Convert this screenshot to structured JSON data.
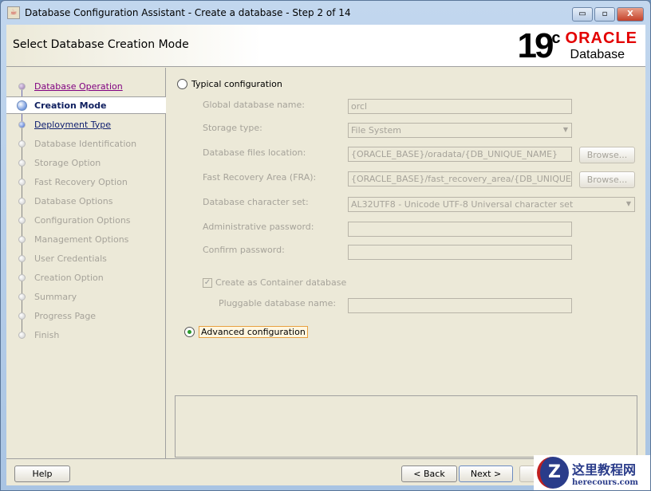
{
  "window": {
    "title": "Database Configuration Assistant - Create a database - Step 2 of 14",
    "minimize": "▭",
    "maximize": "▫",
    "close": "X"
  },
  "header": {
    "title": "Select Database Creation Mode",
    "logo": {
      "version": "19",
      "sup": "c",
      "brand": "ORACLE",
      "product": "Database"
    }
  },
  "steps": [
    {
      "label": "Database Operation",
      "state": "visited"
    },
    {
      "label": "Creation Mode",
      "state": "cur"
    },
    {
      "label": "Deployment Type",
      "state": "next"
    },
    {
      "label": "Database Identification",
      "state": "disabled"
    },
    {
      "label": "Storage Option",
      "state": "disabled"
    },
    {
      "label": "Fast Recovery Option",
      "state": "disabled"
    },
    {
      "label": "Database Options",
      "state": "disabled"
    },
    {
      "label": "Configuration Options",
      "state": "disabled"
    },
    {
      "label": "Management Options",
      "state": "disabled"
    },
    {
      "label": "User Credentials",
      "state": "disabled"
    },
    {
      "label": "Creation Option",
      "state": "disabled"
    },
    {
      "label": "Summary",
      "state": "disabled"
    },
    {
      "label": "Progress Page",
      "state": "disabled"
    },
    {
      "label": "Finish",
      "state": "disabled"
    }
  ],
  "form": {
    "typical_label": "Typical configuration",
    "global_db_name_label": "Global database name:",
    "global_db_name": "orcl",
    "storage_type_label": "Storage type:",
    "storage_type": "File System",
    "db_files_location_label": "Database files location:",
    "db_files_location": "{ORACLE_BASE}/oradata/{DB_UNIQUE_NAME}",
    "fra_label": "Fast Recovery Area (FRA):",
    "fra": "{ORACLE_BASE}/fast_recovery_area/{DB_UNIQUE_NAME}",
    "charset_label": "Database character set:",
    "charset": "AL32UTF8 - Unicode UTF-8 Universal character set",
    "admin_pw_label": "Administrative password:",
    "admin_pw": "",
    "confirm_pw_label": "Confirm password:",
    "confirm_pw": "",
    "container_label": "Create as Container database",
    "container_checked": true,
    "pdb_name_label": "Pluggable database name:",
    "pdb_name": "",
    "browse": "Browse...",
    "advanced_label": "Advanced configuration",
    "selected": "advanced"
  },
  "footer": {
    "help": "Help",
    "back": "< Back",
    "next": "Next >"
  },
  "watermark": {
    "cn": "这里教程网",
    "url": "herecours.com",
    "mark": "Z"
  }
}
